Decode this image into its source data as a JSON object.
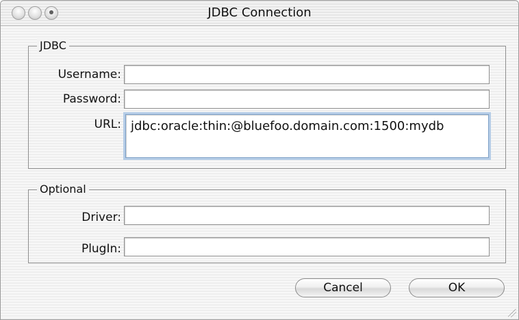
{
  "window": {
    "title": "JDBC Connection"
  },
  "titlebar": {
    "close": "close",
    "minimize": "minimize",
    "zoom": "zoom"
  },
  "jdbc_group": {
    "label": "JDBC",
    "username_label": "Username:",
    "username_value": "",
    "password_label": "Password:",
    "password_value": "",
    "url_label": "URL:",
    "url_value": "jdbc:oracle:thin:@bluefoo.domain.com:1500:mydb"
  },
  "optional_group": {
    "label": "Optional",
    "driver_label": "Driver:",
    "driver_value": "",
    "plugin_label": "PlugIn:",
    "plugin_value": ""
  },
  "buttons": {
    "cancel": "Cancel",
    "ok": "OK"
  },
  "colors": {
    "focus_ring": "#b6cde7",
    "focus_border": "#7c9fc6"
  }
}
